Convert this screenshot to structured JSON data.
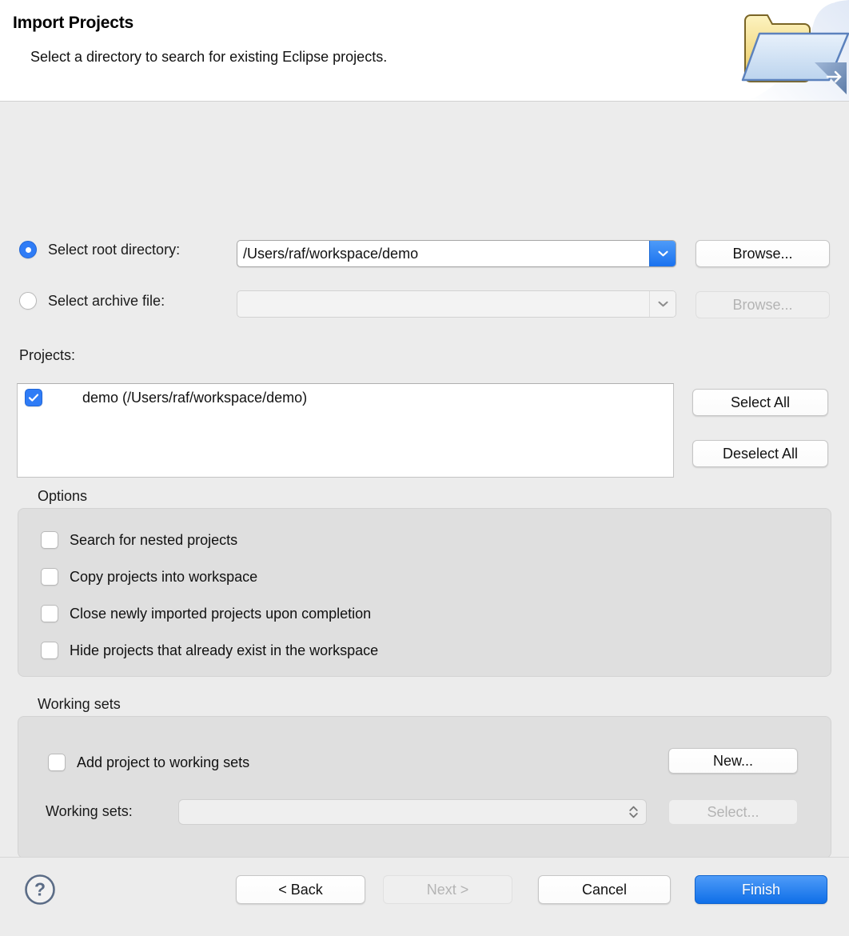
{
  "header": {
    "title": "Import Projects",
    "subtitle": "Select a directory to search for existing Eclipse projects.",
    "icon": "import-folder-icon"
  },
  "source": {
    "root_directory": {
      "radio_label": "Select root directory:",
      "selected": true,
      "value": "/Users/raf/workspace/demo",
      "dropdown_icon": "chevron-down-icon",
      "browse_label": "Browse...",
      "browse_enabled": true
    },
    "archive_file": {
      "radio_label": "Select archive file:",
      "selected": false,
      "value": "",
      "dropdown_icon": "chevron-down-icon",
      "browse_label": "Browse...",
      "browse_enabled": false
    }
  },
  "projects": {
    "label": "Projects:",
    "items": [
      {
        "name": "demo (/Users/raf/workspace/demo)",
        "checked": true
      }
    ],
    "select_all_label": "Select All",
    "deselect_all_label": "Deselect All"
  },
  "options": {
    "title": "Options",
    "items": [
      {
        "label": "Search for nested projects",
        "checked": false
      },
      {
        "label": "Copy projects into workspace",
        "checked": false
      },
      {
        "label": "Close newly imported projects upon completion",
        "checked": false
      },
      {
        "label": "Hide projects that already exist in the workspace",
        "checked": false
      }
    ]
  },
  "working_sets": {
    "title": "Working sets",
    "add_checkbox_label": "Add project to working sets",
    "add_checkbox_checked": false,
    "new_label": "New...",
    "combo_label": "Working sets:",
    "combo_value": "",
    "combo_icon": "stepper-up-down-icon",
    "select_label": "Select...",
    "select_enabled": false
  },
  "footer": {
    "help_icon": "help-question-icon",
    "back_label": "< Back",
    "back_enabled": true,
    "next_label": "Next >",
    "next_enabled": false,
    "cancel_label": "Cancel",
    "cancel_enabled": true,
    "finish_label": "Finish",
    "finish_enabled": true
  },
  "colors": {
    "accent": "#2f7cf6",
    "primary_button": "#0f6fe8",
    "background": "#ececec",
    "group_background": "#dfdfdf",
    "header_background": "#ffffff"
  }
}
